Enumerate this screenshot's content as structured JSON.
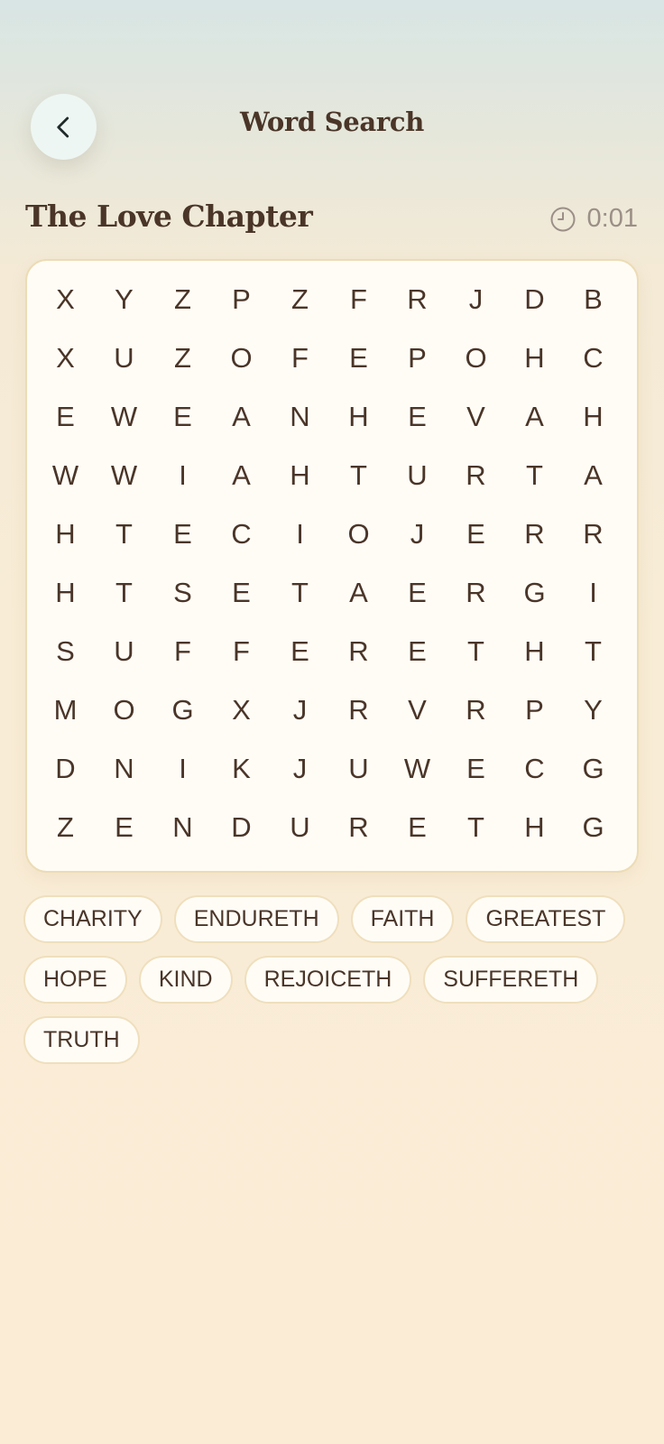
{
  "header": {
    "back_icon": "chevron-left-icon",
    "title": "Word Search"
  },
  "puzzle": {
    "title": "The Love Chapter",
    "timer_icon": "clock-icon",
    "timer": "0:01"
  },
  "grid": [
    [
      "X",
      "Y",
      "Z",
      "P",
      "Z",
      "F",
      "R",
      "J",
      "D",
      "B"
    ],
    [
      "X",
      "U",
      "Z",
      "O",
      "F",
      "E",
      "P",
      "O",
      "H",
      "C"
    ],
    [
      "E",
      "W",
      "E",
      "A",
      "N",
      "H",
      "E",
      "V",
      "A",
      "H"
    ],
    [
      "W",
      "W",
      "I",
      "A",
      "H",
      "T",
      "U",
      "R",
      "T",
      "A"
    ],
    [
      "H",
      "T",
      "E",
      "C",
      "I",
      "O",
      "J",
      "E",
      "R",
      "R"
    ],
    [
      "H",
      "T",
      "S",
      "E",
      "T",
      "A",
      "E",
      "R",
      "G",
      "I"
    ],
    [
      "S",
      "U",
      "F",
      "F",
      "E",
      "R",
      "E",
      "T",
      "H",
      "T"
    ],
    [
      "M",
      "O",
      "G",
      "X",
      "J",
      "R",
      "V",
      "R",
      "P",
      "Y"
    ],
    [
      "D",
      "N",
      "I",
      "K",
      "J",
      "U",
      "W",
      "E",
      "C",
      "G"
    ],
    [
      "Z",
      "E",
      "N",
      "D",
      "U",
      "R",
      "E",
      "T",
      "H",
      "G"
    ]
  ],
  "words": [
    "CHARITY",
    "ENDURETH",
    "FAITH",
    "GREATEST",
    "HOPE",
    "KIND",
    "REJOICETH",
    "SUFFERETH",
    "TRUTH"
  ],
  "colors": {
    "text": "#4a3528",
    "muted": "#9b8f86",
    "card_bg": "#fffcf6",
    "card_border": "#ecdcb5"
  }
}
